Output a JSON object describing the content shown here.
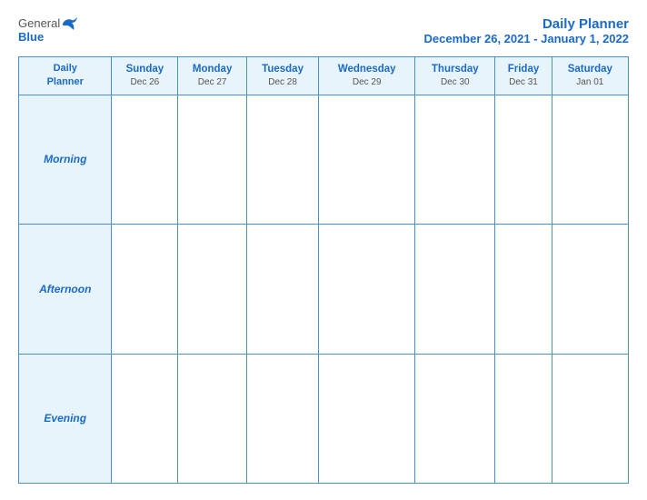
{
  "header": {
    "logo": {
      "general": "General",
      "blue": "Blue"
    },
    "title": "Daily Planner",
    "date_range": "December 26, 2021 - January 1, 2022"
  },
  "table": {
    "label_header_line1": "Daily",
    "label_header_line2": "Planner",
    "columns": [
      {
        "day": "Sunday",
        "date": "Dec 26"
      },
      {
        "day": "Monday",
        "date": "Dec 27"
      },
      {
        "day": "Tuesday",
        "date": "Dec 28"
      },
      {
        "day": "Wednesday",
        "date": "Dec 29"
      },
      {
        "day": "Thursday",
        "date": "Dec 30"
      },
      {
        "day": "Friday",
        "date": "Dec 31"
      },
      {
        "day": "Saturday",
        "date": "Jan 01"
      }
    ],
    "rows": [
      {
        "label": "Morning"
      },
      {
        "label": "Afternoon"
      },
      {
        "label": "Evening"
      }
    ]
  }
}
